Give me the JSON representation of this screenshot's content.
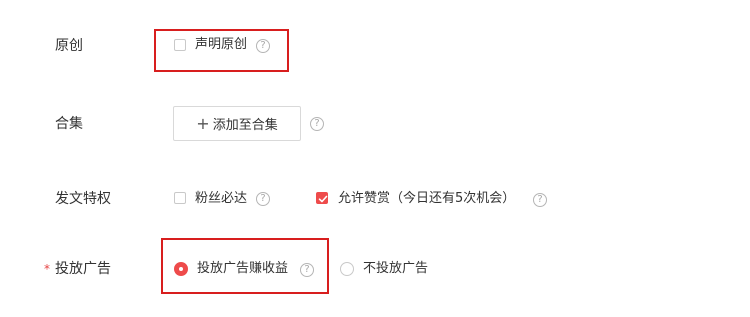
{
  "original": {
    "label": "原创",
    "declare_label": "声明原创",
    "declare_checked": false
  },
  "collection": {
    "label": "合集",
    "add_button": "添加至合集"
  },
  "privileges": {
    "label": "发文特权",
    "fans_label": "粉丝必达",
    "fans_checked": false,
    "reward_label": "允许赞赏（今日还有5次机会）",
    "reward_checked": true
  },
  "ads": {
    "required_mark": "*",
    "label": "投放广告",
    "options": [
      {
        "label": "投放广告赚收益",
        "selected": true
      },
      {
        "label": "不投放广告",
        "selected": false
      }
    ]
  },
  "icons": {
    "help": "question-circle-icon",
    "add": "plus-icon",
    "check": "check-icon"
  },
  "colors": {
    "accent": "#ee4b4b",
    "highlight_box": "#d81e1e"
  }
}
